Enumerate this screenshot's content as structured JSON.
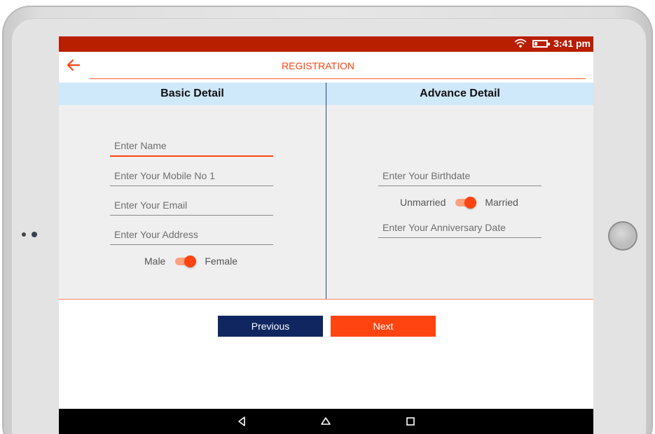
{
  "status_bar": {
    "time": "3:41 pm",
    "icons": [
      "wifi-icon",
      "battery-icon"
    ]
  },
  "app_bar": {
    "title": "REGISTRATION",
    "back_icon": "arrow-left-icon"
  },
  "tabs": {
    "basic": "Basic Detail",
    "advance": "Advance Detail"
  },
  "basic_form": {
    "name_placeholder": "Enter Name",
    "mobile_placeholder": "Enter Your Mobile No 1",
    "email_placeholder": "Enter Your Email",
    "address_placeholder": "Enter Your Address",
    "gender": {
      "left_label": "Male",
      "right_label": "Female",
      "selected": "Female"
    }
  },
  "advance_form": {
    "birthdate_placeholder": "Enter Your Birthdate",
    "marital": {
      "left_label": "Unmarried",
      "right_label": "Married",
      "selected": "Married"
    },
    "anniversary_placeholder": "Enter Your Anniversary Date"
  },
  "buttons": {
    "previous": "Previous",
    "next": "Next"
  },
  "nav_bar": {
    "icons": [
      "back-triangle-icon",
      "home-icon",
      "recents-icon"
    ]
  },
  "colors": {
    "accent": "#ff4411",
    "status_bar": "#b81e00",
    "tab_header": "#cfe8fa",
    "primary_dark": "#0f2660"
  }
}
